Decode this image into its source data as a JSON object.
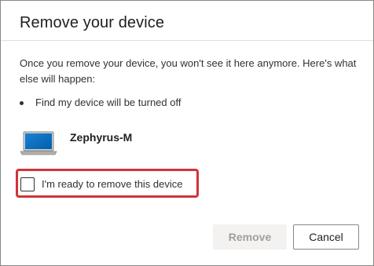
{
  "dialog": {
    "title": "Remove your device",
    "description": "Once you remove your device, you won't see it here anymore. Here's what else will happen:",
    "bullets": [
      "Find my device will be turned off"
    ],
    "device": {
      "name": "Zephyrus-M",
      "icon": "laptop-icon"
    },
    "confirm_checkbox": {
      "label": "I'm ready to remove this device",
      "checked": false
    },
    "buttons": {
      "remove_label": "Remove",
      "remove_enabled": false,
      "cancel_label": "Cancel"
    }
  },
  "colors": {
    "highlight_border": "#d13438",
    "laptop_screen": "#0078d4",
    "disabled_button_bg": "#f3f2f1",
    "disabled_button_text": "#a19f9d"
  }
}
